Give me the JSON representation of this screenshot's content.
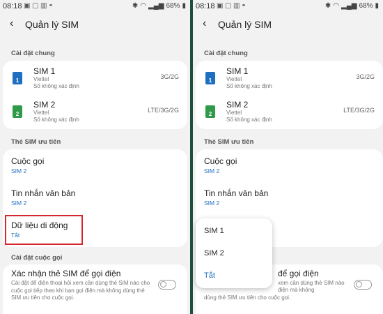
{
  "status": {
    "time": "08:18",
    "battery": "68%"
  },
  "app": {
    "title": "Quản lý SIM"
  },
  "sections": {
    "general": "Cài đặt chung",
    "preferred": "Thẻ SIM ưu tiên",
    "call_settings": "Cài đặt cuộc gọi"
  },
  "sims": [
    {
      "name": "SIM 1",
      "carrier": "Viettel",
      "number": "Số không xác định",
      "network": "3G/2G",
      "badge": "1"
    },
    {
      "name": "SIM 2",
      "carrier": "Viettel",
      "number": "Số không xác định",
      "network": "LTE/3G/2G",
      "badge": "2"
    }
  ],
  "preferred": [
    {
      "label": "Cuộc gọi",
      "value": "SIM 2"
    },
    {
      "label": "Tin nhắn văn bản",
      "value": "SIM 2"
    },
    {
      "label": "Dữ liệu di động",
      "value": "Tắt"
    }
  ],
  "confirm": {
    "title": "Xác nhận thẻ SIM để gọi điện",
    "title_partial": "để gọi điện",
    "desc": "Cài đặt để điện thoại hỏi xem cần dùng thẻ SIM nào cho cuộc gọi tiếp theo khi bạn gọi điện mà không dùng thẻ SIM ưu tiên cho cuộc gọi.",
    "desc_line1_partial": "xem cần dùng thẻ SIM nào",
    "desc_line2_partial": "điện mà không",
    "desc_line3": "dùng thẻ SIM ưu tiên cho cuộc gọi."
  },
  "popup": {
    "options": [
      "SIM 1",
      "SIM 2",
      "Tắt"
    ],
    "selected": "Tắt"
  },
  "colors": {
    "accent": "#1f6fc1",
    "highlight": "#d7262d",
    "sim1": "#1f6fc1",
    "sim2": "#2f9a4a"
  }
}
